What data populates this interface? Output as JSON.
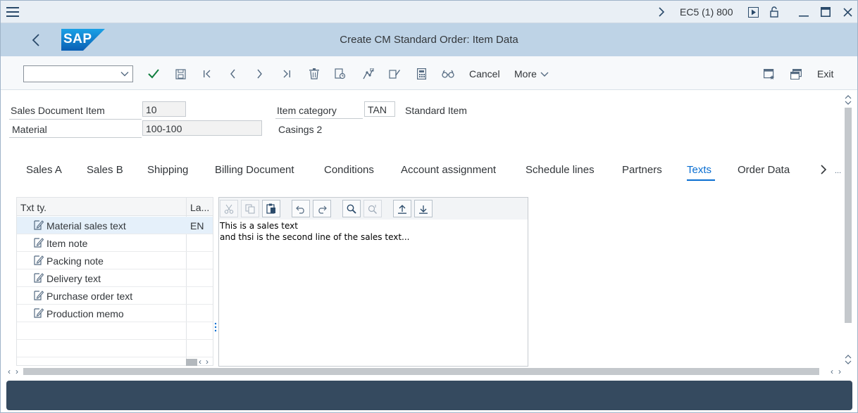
{
  "system": {
    "name": "EC5 (1) 800"
  },
  "titlebar": {
    "title": "Create CM Standard Order: Item Data",
    "logo_text": "SAP"
  },
  "toolbar": {
    "cancel_label": "Cancel",
    "more_label": "More",
    "exit_label": "Exit"
  },
  "header": {
    "sales_doc_item_label": "Sales Document Item",
    "sales_doc_item_value": "10",
    "material_label": "Material",
    "material_value": "100-100",
    "material_desc": "Casings 2",
    "item_category_label": "Item category",
    "item_category_value": "TAN",
    "item_category_desc": "Standard Item"
  },
  "tabs": [
    {
      "label": "Sales A"
    },
    {
      "label": "Sales B"
    },
    {
      "label": "Shipping"
    },
    {
      "label": "Billing Document"
    },
    {
      "label": "Conditions"
    },
    {
      "label": "Account assignment"
    },
    {
      "label": "Schedule lines"
    },
    {
      "label": "Partners"
    },
    {
      "label": "Texts"
    },
    {
      "label": "Order Data"
    }
  ],
  "active_tab": "Texts",
  "tabs_more": "...",
  "text_types": {
    "col_type": "Txt ty.",
    "col_lang": "La...",
    "rows": [
      {
        "name": "Material sales text",
        "lang": "EN"
      },
      {
        "name": "Item note",
        "lang": ""
      },
      {
        "name": "Packing note",
        "lang": ""
      },
      {
        "name": "Delivery text",
        "lang": ""
      },
      {
        "name": "Purchase order text",
        "lang": ""
      },
      {
        "name": "Production memo",
        "lang": ""
      }
    ]
  },
  "editor": {
    "line1": "This is a sales text",
    "line2": "and thsi is the second line of the sales text..."
  },
  "colors": {
    "accent": "#0a6ed1",
    "shell_header": "#bed3e6",
    "status_bar": "#354a5f",
    "check_green": "#107e3e"
  }
}
